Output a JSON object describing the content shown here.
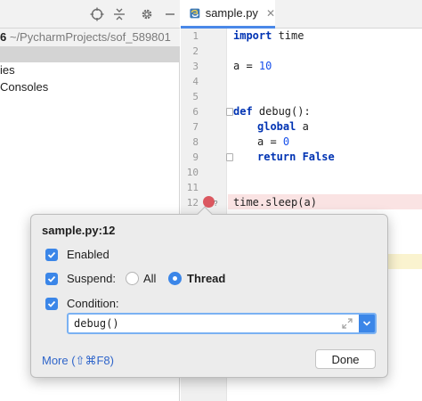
{
  "project_panel": {
    "path_bold": "6",
    "path": " ~/PycharmProjects/sof_589801",
    "items": [
      "ies",
      " Consoles"
    ]
  },
  "editor": {
    "tab_label": "sample.py",
    "line_numbers": [
      "1",
      "2",
      "3",
      "4",
      "5",
      "6",
      "7",
      "8",
      "9",
      "10",
      "11",
      "12"
    ],
    "code": {
      "l1_kw": "import",
      "l1_rest": " time",
      "l3_var": "a = ",
      "l3_num": "10",
      "l6_kw": "def",
      "l6_rest": " debug():",
      "l7_kw": "global",
      "l7_rest": " a",
      "l8_var": "a = ",
      "l8_num": "0",
      "l9_kw": "return",
      "l9_kw2": " False",
      "l12": "time.sleep(a)"
    },
    "breakpoint_hint": "?"
  },
  "popup": {
    "title": "sample.py:12",
    "enabled_label": "Enabled",
    "suspend_label": "Suspend:",
    "all_label": "All",
    "thread_label": "Thread",
    "condition_label": "Condition:",
    "condition_value": "debug()",
    "more_link": "More (⇧⌘F8)",
    "done_label": "Done"
  },
  "colors": {
    "accent": "#3b86e8",
    "breakpoint": "#db5860",
    "keyword": "#0033b3",
    "number": "#1750eb"
  },
  "icons": [
    "crosshair-icon",
    "collapse-icon",
    "gear-icon",
    "minimize-icon",
    "python-file-icon",
    "close-icon",
    "breakpoint-icon",
    "expand-icon",
    "chevron-down-icon",
    "checkmark-icon"
  ]
}
